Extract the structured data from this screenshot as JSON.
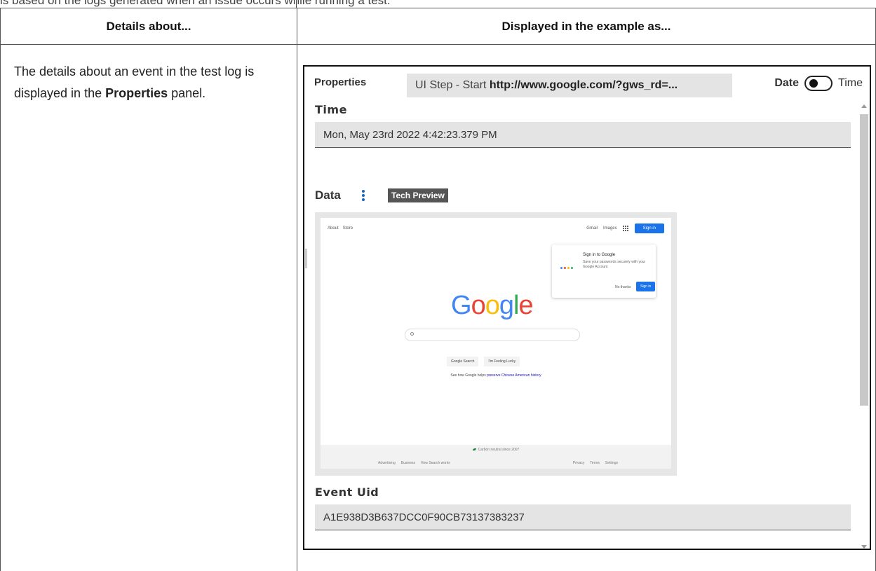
{
  "top_text": "is based on the logs generated when an issue occurs while running a test.",
  "table": {
    "header_left": "Details about...",
    "header_right": "Displayed in the example as...",
    "desc_pre": "The details about an event in the test log is displayed in the ",
    "desc_bold": "Properties",
    "desc_post": " panel."
  },
  "panel": {
    "title": "Properties",
    "step_prefix": "UI Step - Start ",
    "step_url": "http://www.google.com/?gws_rd=...",
    "toggle_left": "Date",
    "toggle_right": "Time",
    "time_label": "Time",
    "time_value": "Mon, May 23rd 2022 4:42:23.379 PM",
    "data_label": "Data",
    "badge": "Tech Preview",
    "event_uid_label": "Event Uid",
    "event_uid_value": "A1E938D3B637DCC0F90CB73137383237",
    "icons": [
      "kebab-menu-icon",
      "apps-grid-icon",
      "search-icon",
      "leaf-icon"
    ]
  },
  "google": {
    "top_left": [
      "About",
      "Store"
    ],
    "gmail": "Gmail",
    "images": "Images",
    "sign_in": "Sign in",
    "popup_title": "Sign in to Google",
    "popup_text": "Save your passwords securely with your Google Account",
    "popup_no": "No thanks",
    "popup_yes": "Sign in",
    "logo_letters": [
      "G",
      "o",
      "o",
      "g",
      "l",
      "e"
    ],
    "logo_colors": [
      "#4285F4",
      "#EA4335",
      "#FBBC05",
      "#4285F4",
      "#34A853",
      "#EA4335"
    ],
    "btn_search": "Google Search",
    "btn_lucky": "I'm Feeling Lucky",
    "help_pre": "See how Google helps ",
    "help_link": "preserve Chinese American history",
    "carbon": "Carbon neutral since 2007",
    "footer_left": [
      "Advertising",
      "Business",
      "How Search works"
    ],
    "footer_right": [
      "Privacy",
      "Terms",
      "Settings"
    ]
  }
}
